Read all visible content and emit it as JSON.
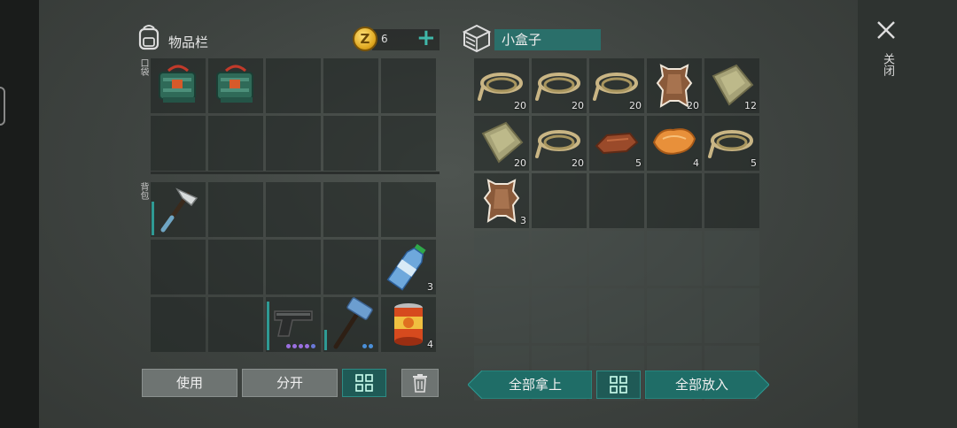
{
  "inventory": {
    "title": "物品栏",
    "coin_count": "6",
    "coin_symbol": "Z",
    "plus": "+",
    "pocket_label": "口袋",
    "backpack_label": "背包"
  },
  "container": {
    "name": "小盒子"
  },
  "close": {
    "label": "关闭"
  },
  "buttons": {
    "use": "使用",
    "split": "分开",
    "take_all": "全部拿上",
    "put_all": "全部放入"
  },
  "pockets": [
    {
      "item": "toolbox-icon",
      "qty": ""
    },
    {
      "item": "toolbox-icon",
      "qty": ""
    },
    {
      "item": "",
      "qty": ""
    },
    {
      "item": "",
      "qty": ""
    },
    {
      "item": "",
      "qty": ""
    },
    {
      "item": "",
      "qty": ""
    },
    {
      "item": "",
      "qty": ""
    },
    {
      "item": "",
      "qty": ""
    },
    {
      "item": "",
      "qty": ""
    },
    {
      "item": "",
      "qty": ""
    }
  ],
  "backpack": [
    {
      "item": "hatchet-icon",
      "qty": "",
      "durability": 0.65
    },
    {
      "item": "",
      "qty": ""
    },
    {
      "item": "",
      "qty": ""
    },
    {
      "item": "",
      "qty": ""
    },
    {
      "item": "",
      "qty": ""
    },
    {
      "item": "",
      "qty": ""
    },
    {
      "item": "",
      "qty": ""
    },
    {
      "item": "",
      "qty": ""
    },
    {
      "item": "",
      "qty": ""
    },
    {
      "item": "water-bottle-icon",
      "qty": "3"
    },
    {
      "item": "",
      "qty": ""
    },
    {
      "item": "",
      "qty": ""
    },
    {
      "item": "pistol-icon",
      "qty": "",
      "durability": 0.95,
      "dots": [
        "#9a6fe0",
        "#9a6fe0",
        "#9a6fe0",
        "#9a6fe0",
        "#6a78d8"
      ]
    },
    {
      "item": "hammer-icon",
      "qty": "",
      "durability": 0.4,
      "dots": [
        "#4a8fd8",
        "#4a8fd8"
      ]
    },
    {
      "item": "canned-food-icon",
      "qty": "4"
    }
  ],
  "box": [
    {
      "item": "rope-icon",
      "qty": "20"
    },
    {
      "item": "rope-icon",
      "qty": "20"
    },
    {
      "item": "rope-icon",
      "qty": "20"
    },
    {
      "item": "animal-hide-icon",
      "qty": "20"
    },
    {
      "item": "cloth-icon",
      "qty": "12"
    },
    {
      "item": "cloth-icon",
      "qty": "20"
    },
    {
      "item": "rope-icon",
      "qty": "20"
    },
    {
      "item": "leather-icon",
      "qty": "5"
    },
    {
      "item": "fur-icon",
      "qty": "4"
    },
    {
      "item": "rope-icon",
      "qty": "5"
    },
    {
      "item": "animal-hide-icon",
      "qty": "3"
    }
  ],
  "colors": {
    "accent": "#2a6f6a",
    "teal_button": "#1f6d67",
    "gray_button": "#6e7472"
  }
}
